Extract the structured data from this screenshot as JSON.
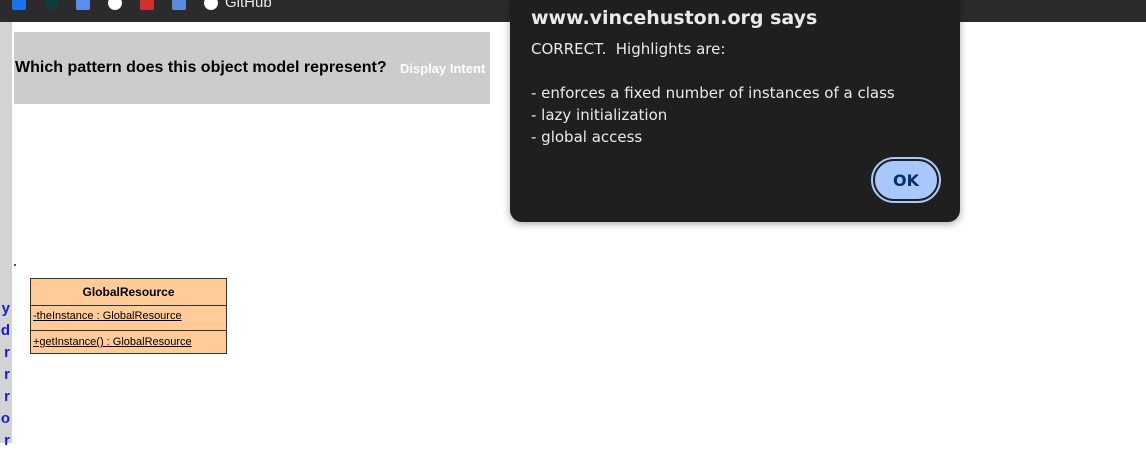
{
  "bookmarks_bar": {
    "icons": [
      {
        "name": "mail-icon",
        "color": "#1a73e8"
      },
      {
        "name": "circle-app-icon",
        "color": "#0f3b3e"
      },
      {
        "name": "calendar-icon",
        "color": "#5b8def"
      },
      {
        "name": "openai-icon",
        "color": "#ffffff"
      },
      {
        "name": "red-bookmark-icon",
        "color": "#d32f2f"
      },
      {
        "name": "tool-bookmark-icon",
        "color": "#5a8dd6"
      },
      {
        "name": "github-icon",
        "color": "#ffffff"
      }
    ],
    "github_label": "GitHub"
  },
  "sidebar": {
    "letters": [
      "y",
      "d",
      "r",
      "r",
      "r",
      "o",
      "r"
    ]
  },
  "question": {
    "text": "Which pattern does this object model represent?",
    "intent_link": "Display Intent"
  },
  "uml": {
    "class_name": "GlobalResource",
    "attribute": "-theInstance : GlobalResource",
    "operation": "+getInstance() : GlobalResource",
    "fill_color": "#ffcc99"
  },
  "dialog": {
    "title": "www.vincehuston.org says",
    "lines": [
      "CORRECT.  Highlights are:",
      "",
      "- enforces a fixed number of instances of a class",
      "- lazy initialization",
      "- global access"
    ],
    "ok_label": "OK",
    "button_color": "#a8c7fa"
  }
}
